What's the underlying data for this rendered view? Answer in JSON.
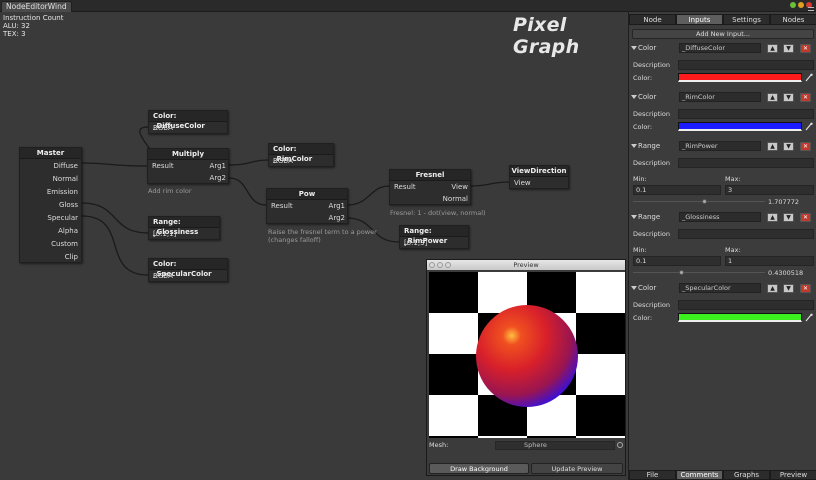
{
  "window": {
    "tab_title": "NodeEditorWind"
  },
  "stats": {
    "title": "Instruction Count",
    "alu": "ALU: 32",
    "tex": "TEX: 3"
  },
  "logo": "Pixel Graph",
  "nodes": {
    "master": {
      "title": "Master",
      "inputs": [
        "Diffuse",
        "Normal",
        "Emission",
        "Gloss",
        "Specular",
        "Alpha",
        "Custom",
        "Clip"
      ]
    },
    "diffuse_color": {
      "title": "Color: _DiffuseColor",
      "value": "RGBA"
    },
    "multiply": {
      "title": "Multiply",
      "output": "Result",
      "in1": "Arg1",
      "in2": "Arg2",
      "comment": "Add rim color"
    },
    "rim_color": {
      "title": "Color: _RimColor",
      "value": "RGBA"
    },
    "pow": {
      "title": "Pow",
      "output": "Result",
      "in1": "Arg1",
      "in2": "Arg2",
      "comment": "Raise the fresnel term to a power (changes falloff)"
    },
    "fresnel": {
      "title": "Fresnel",
      "output": "Result",
      "in1": "View",
      "in2": "Normal",
      "comment": "Fresnel: 1 - dot(view, normal)"
    },
    "view_direction": {
      "title": "ViewDirection",
      "output": "View"
    },
    "glossiness": {
      "title": "Range: _Glossiness",
      "value": "[0.1,1]"
    },
    "rim_power": {
      "title": "Range: _RimPower",
      "value": "[0.1,3]"
    },
    "specular_color": {
      "title": "Color: _SpecularColor",
      "value": "RGBA"
    }
  },
  "preview": {
    "title": "Preview",
    "mesh_label": "Mesh:",
    "mesh_value": "Sphere",
    "draw_background": "Draw Background",
    "update_preview": "Update Preview"
  },
  "panel": {
    "tabs": [
      "Node",
      "Inputs",
      "Settings",
      "Nodes"
    ],
    "active_tab": "Inputs",
    "add_button": "Add New Input...",
    "labels": {
      "description": "Description",
      "color": "Color:",
      "min": "Min:",
      "max": "Max:"
    },
    "entries": [
      {
        "type": "Color",
        "name": "_DiffuseColor",
        "color": "#ff1b1b"
      },
      {
        "type": "Color",
        "name": "_RimColor",
        "color": "#1b1bff"
      },
      {
        "type": "Range",
        "name": "_RimPower",
        "min": "0.1",
        "max": "3",
        "value": "1.707772",
        "fraction": 0.54
      },
      {
        "type": "Range",
        "name": "_Glossiness",
        "min": "0.1",
        "max": "1",
        "value": "0.4300518",
        "fraction": 0.36
      },
      {
        "type": "Color",
        "name": "_SpecularColor",
        "color": "#3cef1f"
      }
    ],
    "bottom_tabs": [
      "File",
      "Comments",
      "Graphs",
      "Preview"
    ],
    "active_bottom_tab": "Comments"
  },
  "icons": {
    "up": "arrow-up-icon",
    "down": "arrow-down-icon",
    "delete": "delete-icon",
    "picker": "eyedropper-icon"
  }
}
